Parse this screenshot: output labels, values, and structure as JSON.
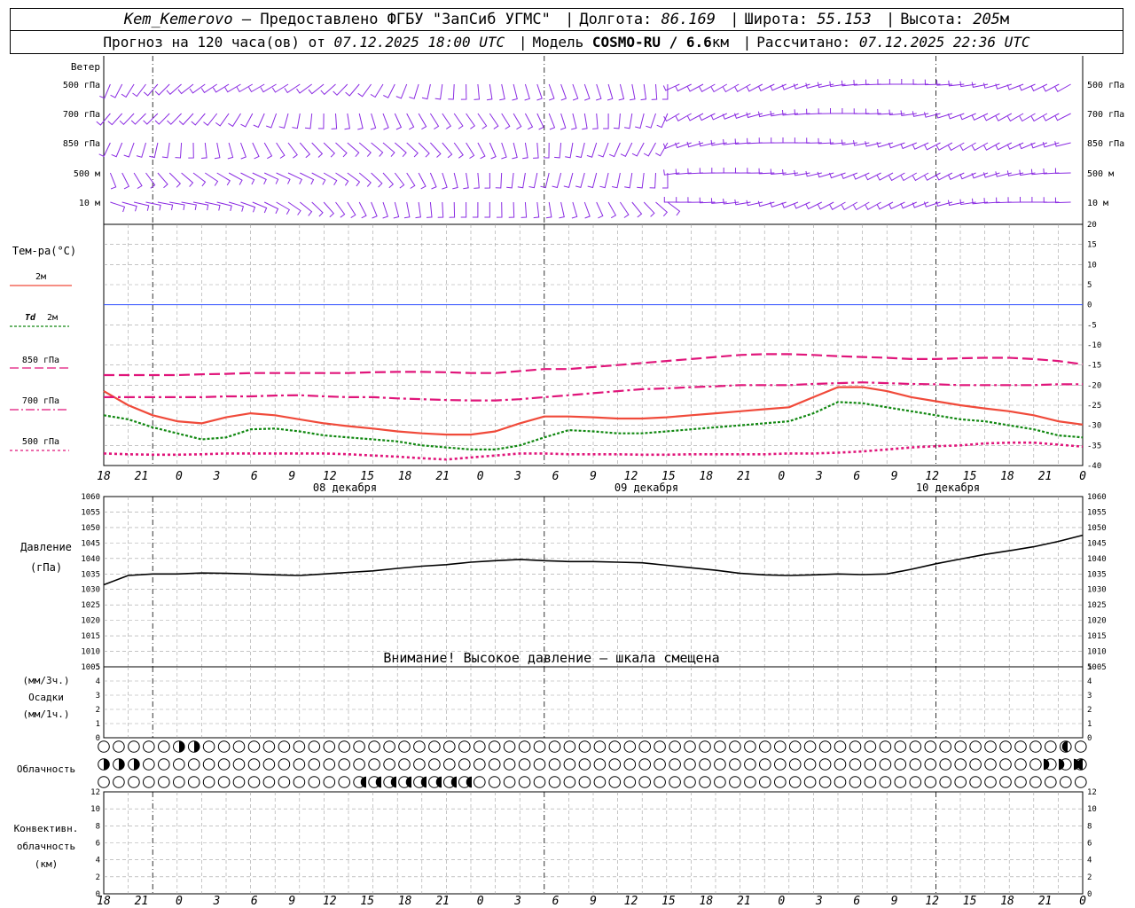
{
  "header": {
    "station": "Kem_Kemerovo",
    "provider": "— Предоставлено ФГБУ \"ЗапСиб УГМС\"",
    "lon_label": "Долгота:",
    "lon": "86.169",
    "lat_label": "Широта:",
    "lat": "55.153",
    "alt_label": "Высота:",
    "alt": "205",
    "alt_unit": "м",
    "forecast_label": "Прогноз на 120 часа(ов) от",
    "forecast_from": "07.12.2025 18:00 UTC",
    "model_label": "Модель",
    "model": "COSMO-RU / 6.6",
    "model_unit": "км",
    "computed_label": "Рассчитано:",
    "computed": "07.12.2025 22:36 UTC"
  },
  "colors": {
    "wind": "#8a2be2",
    "t2m": "#f04a3a",
    "td2m": "#118811",
    "t850": "#e0157a",
    "pressure": "#000000",
    "zero_line": "#3050ff",
    "grid": "#a0a0a0"
  },
  "wind_panel": {
    "title": "Ветер",
    "levels": [
      "500 гПа",
      "700 гПа",
      "850 гПа",
      "500 м",
      "10  м"
    ]
  },
  "temp_panel": {
    "title": "Тем-ра(°C)",
    "legend": [
      {
        "label": "2м",
        "style": "solid",
        "color": "#f04a3a"
      },
      {
        "label_italic": "Td",
        "label": "2м",
        "style": "dotted",
        "color": "#118811"
      },
      {
        "label": "850 гПа",
        "style": "dashed",
        "color": "#e0157a"
      },
      {
        "label": "700 гПа",
        "style": "dashdot",
        "color": "#e0157a"
      },
      {
        "label": "500 гПа",
        "style": "dotted",
        "color": "#e0157a"
      }
    ]
  },
  "time_axis": {
    "hour_labels": [
      "18",
      "21",
      "0",
      "3",
      "6",
      "9",
      "12",
      "15",
      "18",
      "21",
      "0",
      "3",
      "6",
      "9",
      "12",
      "15",
      "18",
      "21",
      "0",
      "3",
      "6",
      "9",
      "12",
      "15",
      "18",
      "21",
      "0"
    ],
    "dates": [
      "08 декабря",
      "09 декабря",
      "10 декабря"
    ]
  },
  "pressure_panel": {
    "title": "Давление",
    "unit": "(гПа)",
    "warning": "Внимание! Высокое давление — шкала смещена"
  },
  "precip_panel": {
    "label_3h": "(мм/3ч.)",
    "title": "Осадки",
    "label_1h": "(мм/1ч.)"
  },
  "cloud_panel": {
    "title": "Облачность"
  },
  "convective_panel": {
    "title_1": "Конвективн.",
    "title_2": "облачность",
    "title_3": "(км)"
  },
  "chart_data": [
    {
      "type": "line",
      "name": "temperature",
      "x_hours": [
        0,
        3,
        6,
        9,
        12,
        15,
        18,
        21,
        24,
        27,
        30,
        33,
        36,
        39,
        42,
        45,
        48,
        51,
        54,
        57,
        60,
        63,
        66,
        69,
        72,
        75,
        78,
        81,
        84,
        87,
        90,
        93,
        96,
        99,
        102,
        105,
        108,
        111,
        114,
        117,
        120
      ],
      "ylim": [
        -40,
        20
      ],
      "yticks": [
        -40,
        -35,
        -30,
        -25,
        -20,
        -15,
        -10,
        -5,
        0,
        5,
        10,
        15,
        20
      ],
      "series": [
        {
          "label": "2м",
          "values": [
            -21.5,
            -25,
            -27.5,
            -29,
            -29.5,
            -28,
            -27,
            -27.5,
            -28.5,
            -29.5,
            -30.2,
            -30.8,
            -31.5,
            -32,
            -32.3,
            -32.3,
            -31.5,
            -29.5,
            -27.8,
            -27.8,
            -28,
            -28.3,
            -28.3,
            -28,
            -27.5,
            -27,
            -26.5,
            -26,
            -25.5,
            -23,
            -20.5,
            -20.5,
            -21.5,
            -23,
            -24,
            -25,
            -25.8,
            -26.5,
            -27.5,
            -29,
            -29.8
          ]
        },
        {
          "label": "Td 2м",
          "values": [
            -27.5,
            -28.5,
            -30.5,
            -32,
            -33.5,
            -33,
            -31,
            -30.8,
            -31.5,
            -32.5,
            -33,
            -33.5,
            -34,
            -35,
            -35.5,
            -36,
            -36,
            -35,
            -33,
            -31.2,
            -31.5,
            -32,
            -32,
            -31.5,
            -31,
            -30.5,
            -30,
            -29.5,
            -29,
            -27,
            -24.2,
            -24.5,
            -25.5,
            -26.5,
            -27.5,
            -28.5,
            -29,
            -30,
            -31,
            -32.5,
            -33
          ]
        },
        {
          "label": "850 гПа",
          "values": [
            -17.5,
            -17.5,
            -17.5,
            -17.5,
            -17.3,
            -17.2,
            -17,
            -17,
            -17,
            -17,
            -17,
            -16.8,
            -16.7,
            -16.7,
            -16.8,
            -17,
            -17,
            -16.5,
            -16,
            -16,
            -15.5,
            -15,
            -14.5,
            -14,
            -13.5,
            -13,
            -12.5,
            -12.3,
            -12.3,
            -12.5,
            -12.8,
            -13,
            -13.2,
            -13.5,
            -13.5,
            -13.3,
            -13.2,
            -13.2,
            -13.5,
            -14,
            -14.8
          ]
        },
        {
          "label": "700 гПа",
          "values": [
            -23,
            -23,
            -23,
            -23,
            -23,
            -22.8,
            -22.8,
            -22.6,
            -22.5,
            -22.8,
            -23,
            -23,
            -23.3,
            -23.5,
            -23.7,
            -23.8,
            -23.8,
            -23.5,
            -23,
            -22.5,
            -22,
            -21.5,
            -21,
            -20.8,
            -20.5,
            -20.3,
            -20,
            -20,
            -20,
            -19.7,
            -19.5,
            -19.3,
            -19.5,
            -19.7,
            -19.8,
            -20,
            -20,
            -20,
            -20,
            -19.8,
            -19.8
          ]
        },
        {
          "label": "500 гПа",
          "values": [
            -37,
            -37.2,
            -37.3,
            -37.3,
            -37.2,
            -37,
            -37,
            -37,
            -37,
            -37,
            -37.2,
            -37.5,
            -37.8,
            -38.2,
            -38.5,
            -38,
            -37.5,
            -37,
            -37,
            -37.2,
            -37.2,
            -37.2,
            -37.3,
            -37.3,
            -37.2,
            -37.2,
            -37.2,
            -37.2,
            -37,
            -37,
            -36.8,
            -36.5,
            -36,
            -35.5,
            -35.2,
            -35,
            -34.5,
            -34.3,
            -34.3,
            -34.8,
            -35.3
          ]
        }
      ]
    },
    {
      "type": "line",
      "name": "pressure",
      "x_hours": [
        0,
        3,
        6,
        9,
        12,
        15,
        18,
        21,
        24,
        27,
        30,
        33,
        36,
        39,
        42,
        45,
        48,
        51,
        54,
        57,
        60,
        63,
        66,
        69,
        72,
        75,
        78,
        81,
        84,
        87,
        90,
        93,
        96,
        99,
        102,
        105,
        108,
        111,
        114,
        117,
        120
      ],
      "ylim": [
        1005,
        1060
      ],
      "yticks": [
        1005,
        1010,
        1015,
        1020,
        1025,
        1030,
        1035,
        1040,
        1045,
        1050,
        1055,
        1060
      ],
      "values": [
        1031.5,
        1034.5,
        1035,
        1035,
        1035.3,
        1035.2,
        1035,
        1034.7,
        1034.5,
        1035,
        1035.5,
        1036,
        1036.8,
        1037.5,
        1038,
        1038.8,
        1039.3,
        1039.7,
        1039.3,
        1039,
        1039,
        1038.8,
        1038.6,
        1037.8,
        1037,
        1036.2,
        1035.2,
        1034.7,
        1034.5,
        1034.7,
        1035,
        1034.8,
        1035,
        1036.5,
        1038.3,
        1039.8,
        1041.3,
        1042.5,
        1043.8,
        1045.5,
        1047.5
      ]
    },
    {
      "type": "bar",
      "name": "precipitation",
      "ylim": [
        0,
        5
      ],
      "yticks": [
        0,
        1,
        2,
        3,
        4,
        5
      ],
      "values": []
    },
    {
      "type": "bar",
      "name": "convective_cloud",
      "ylim": [
        0,
        12
      ],
      "yticks": [
        0,
        2,
        4,
        6,
        8,
        10,
        12
      ],
      "values": []
    }
  ]
}
